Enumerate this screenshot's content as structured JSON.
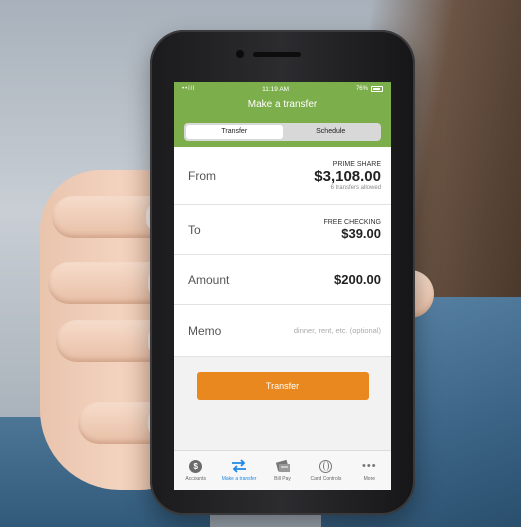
{
  "status_bar": {
    "signal": "••ill",
    "time": "11:19 AM",
    "battery": "76%"
  },
  "header": {
    "title": "Make a transfer"
  },
  "segments": [
    {
      "label": "Transfer",
      "active": true
    },
    {
      "label": "Schedule",
      "active": false
    }
  ],
  "form": {
    "from": {
      "label": "From",
      "account": "PRIME SHARE",
      "amount": "$3,108.00",
      "note": "6 transfers allowed"
    },
    "to": {
      "label": "To",
      "account": "FREE CHECKING",
      "amount": "$39.00"
    },
    "amount": {
      "label": "Amount",
      "value": "$200.00"
    },
    "memo": {
      "label": "Memo",
      "placeholder": "dinner, rent, etc. (optional)"
    }
  },
  "transfer_button": {
    "label": "Transfer"
  },
  "tabbar": [
    {
      "label": "Accounts",
      "icon": "dollar-coin-icon"
    },
    {
      "label": "Make a transfer",
      "icon": "transfer-arrows-icon",
      "active": true
    },
    {
      "label": "Bill Pay",
      "icon": "bill-pay-icon"
    },
    {
      "label": "Card Controls",
      "icon": "globe-icon"
    },
    {
      "label": "More",
      "icon": "more-dots-icon"
    }
  ],
  "colors": {
    "header_green": "#7dae4c",
    "button_orange": "#e9881e",
    "active_tab_blue": "#1e88e5"
  }
}
